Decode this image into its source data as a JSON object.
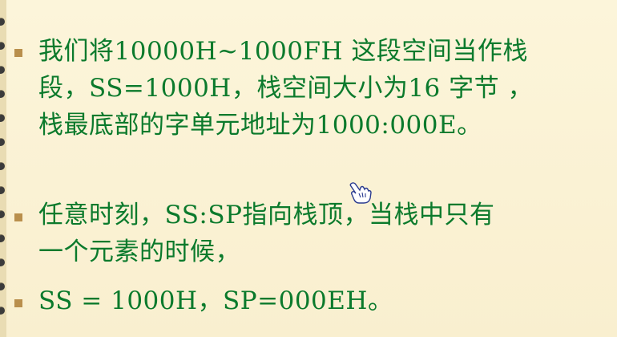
{
  "slide": {
    "bullets": [
      {
        "lines": [
          "我们将10000H~1000FH 这段空间当作栈",
          "段，SS=1000H，栈空间大小为16 字节 ，",
          "栈最底部的字单元地址为1000:000E。"
        ]
      },
      {
        "lines": [
          "任意时刻，SS:SP指向栈顶，当栈中只有",
          "一个元素的时候，"
        ]
      },
      {
        "lines": [
          "SS = 1000H，SP=000EH。"
        ]
      }
    ],
    "colors": {
      "text": "#0b7a2c",
      "bullet": "#b98f4c",
      "background": "#fbf3d6"
    },
    "icons": [
      "spiral-hole-icon",
      "hand-cursor-icon"
    ]
  }
}
